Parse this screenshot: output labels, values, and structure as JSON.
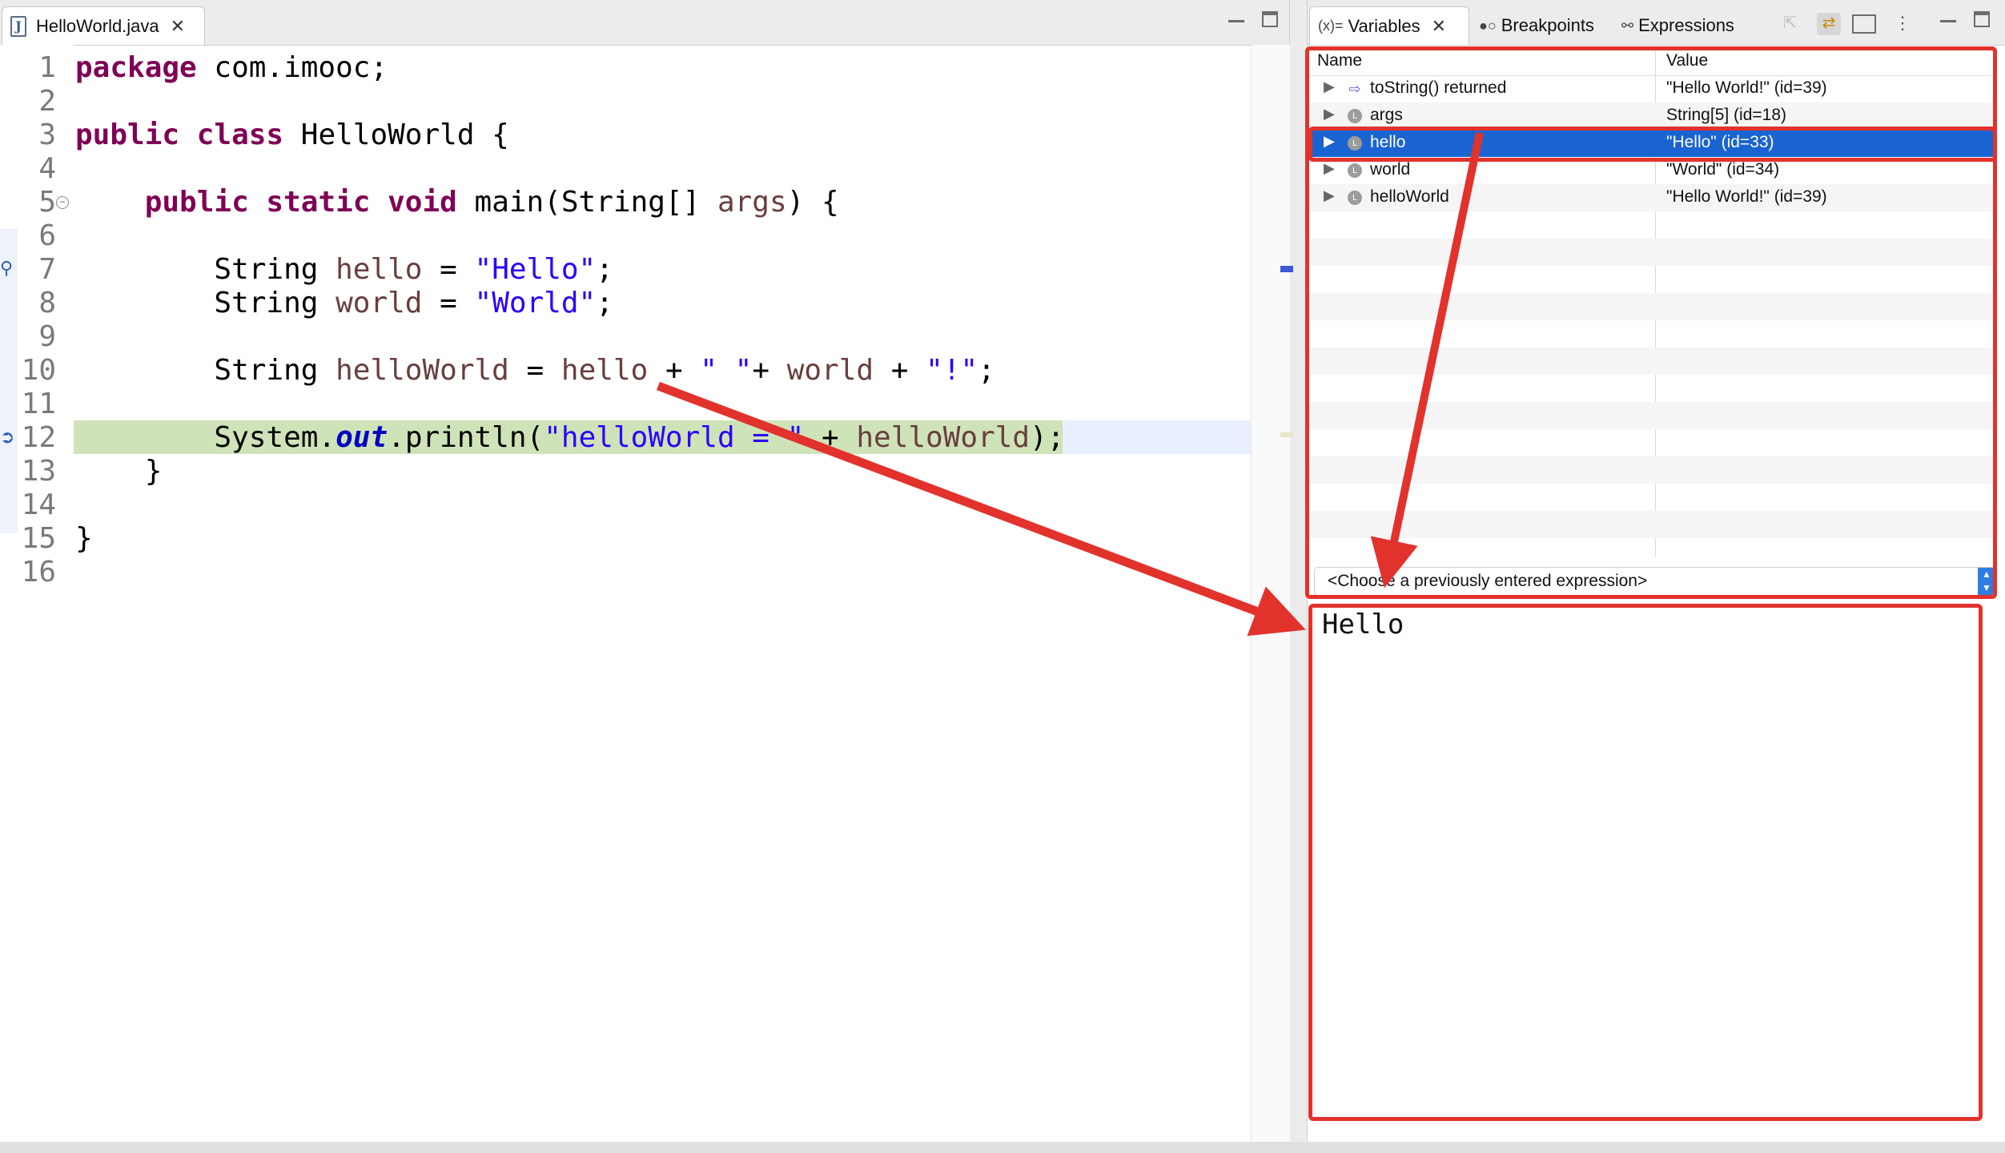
{
  "editor": {
    "tab_title": "HelloWorld.java",
    "line_numbers": [
      "1",
      "2",
      "3",
      "4",
      "5",
      "6",
      "7",
      "8",
      "9",
      "10",
      "11",
      "12",
      "13",
      "14",
      "15",
      "16"
    ]
  },
  "code": {
    "l1": {
      "kw": "package",
      "rest": " com.imooc;"
    },
    "l3": {
      "kw": "public class",
      "rest": " HelloWorld {"
    },
    "l5": {
      "indent": "    ",
      "kw": "public static void",
      "rest": " main(String[] ",
      "var": "args",
      "end": ") {"
    },
    "l7": {
      "indent": "        ",
      "type": "String ",
      "var": "hello",
      "op": " = ",
      "str": "\"Hello\"",
      "end": ";"
    },
    "l8": {
      "indent": "        ",
      "type": "String ",
      "var": "world",
      "op": " = ",
      "str": "\"World\"",
      "end": ";"
    },
    "l10": {
      "indent": "        ",
      "type": "String ",
      "var": "helloWorld",
      "op": " = ",
      "v2": "hello",
      "p1": " + ",
      "s1": "\" \"",
      "p2": "+ ",
      "v3": "world",
      "p3": " + ",
      "s2": "\"!\"",
      "end": ";"
    },
    "l12": {
      "indent": "        ",
      "sys": "System.",
      "fld": "out",
      "call": ".println(",
      "str": "\"helloWorld = \"",
      "plus": " + ",
      "var": "helloWorld",
      "end": ");"
    },
    "l13": {
      "text": "    }"
    },
    "l15": {
      "text": "}"
    }
  },
  "debug": {
    "tabs": [
      {
        "prefix": "(x)=",
        "label": "Variables"
      },
      {
        "label": "Breakpoints"
      },
      {
        "label": "Expressions"
      }
    ],
    "columns": {
      "name": "Name",
      "value": "Value"
    },
    "variables": [
      {
        "name": "toString() returned",
        "value": "\"Hello World!\" (id=39)",
        "icon": "return-icon"
      },
      {
        "name": "args",
        "value": "String[5]  (id=18)",
        "icon": "local-variable-icon"
      },
      {
        "name": "hello",
        "value": "\"Hello\" (id=33)",
        "icon": "local-variable-icon",
        "selected": true
      },
      {
        "name": "world",
        "value": "\"World\" (id=34)",
        "icon": "local-variable-icon"
      },
      {
        "name": "helloWorld",
        "value": "\"Hello World!\" (id=39)",
        "icon": "local-variable-icon"
      }
    ],
    "expression_select": "<Choose a previously entered expression>",
    "detail_value": "Hello"
  },
  "colors": {
    "annotation_red": "#e2322c",
    "selection_blue": "#1a64d2",
    "keyword": "#7f0055",
    "string": "#2a00ff",
    "current_line": "#cfe3b8"
  }
}
